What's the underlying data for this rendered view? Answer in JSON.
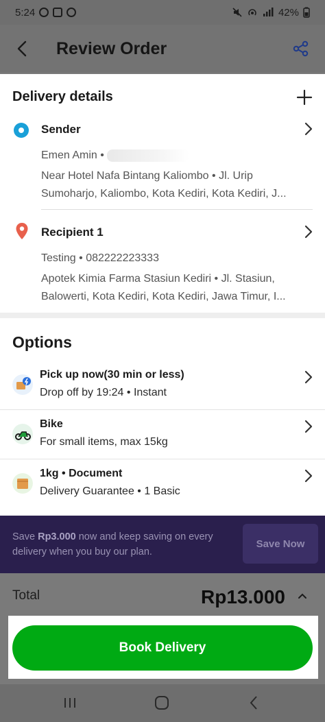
{
  "status_bar": {
    "time": "5:24",
    "battery": "42%"
  },
  "header": {
    "title": "Review Order"
  },
  "delivery": {
    "title": "Delivery details",
    "sender": {
      "label": "Sender",
      "contact": "Emen Amin •",
      "address_line1": "Near Hotel Nafa Bintang Kaliombo • Jl. Urip",
      "address_line2": "Sumoharjo, Kaliombo, Kota Kediri, Kota Kediri, J..."
    },
    "recipient": {
      "label": "Recipient 1",
      "contact": "Testing • 082222223333",
      "address_line1": "Apotek Kimia Farma Stasiun Kediri • Jl. Stasiun,",
      "address_line2": "Balowerti, Kota Kediri, Kota Kediri, Jawa Timur, I..."
    }
  },
  "options": {
    "title": "Options",
    "items": [
      {
        "title": "Pick up now(30 min or less)",
        "subtitle": "Drop off by 19:24 • Instant",
        "icon": "instant-delivery-icon"
      },
      {
        "title": "Bike",
        "subtitle": "For small items, max 15kg",
        "icon": "bike-icon"
      },
      {
        "title": "1kg • Document",
        "subtitle": "Delivery Guarantee • 1 Basic",
        "icon": "package-icon"
      }
    ]
  },
  "promo": {
    "text_prefix": "Save ",
    "text_amount": "Rp3.000",
    "text_suffix": " now and keep saving on every delivery when you buy our plan.",
    "button": "Save Now"
  },
  "total": {
    "label": "Total",
    "value": "Rp13.000"
  },
  "book_button": "Book Delivery",
  "colors": {
    "accent_green": "#00aa13",
    "sender_blue": "#1aa0d8",
    "recipient_red": "#e8604c",
    "promo_bg": "#2a1f4d"
  }
}
